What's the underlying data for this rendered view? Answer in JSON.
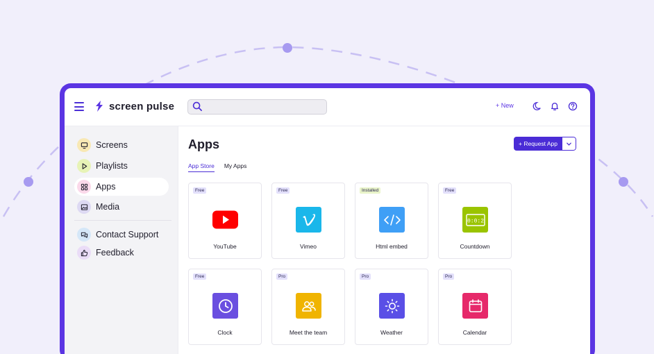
{
  "brand": {
    "name": "screen pulse"
  },
  "search": {
    "placeholder": ""
  },
  "header": {
    "new_label": "+ New"
  },
  "sidebar": {
    "items": [
      {
        "label": "Screens",
        "icon": "monitor-icon",
        "color": "#f8e8b4"
      },
      {
        "label": "Playlists",
        "icon": "play-icon",
        "color": "#e7f3b6"
      },
      {
        "label": "Apps",
        "icon": "grid-icon",
        "color": "#fbd9ea"
      },
      {
        "label": "Media",
        "icon": "image-icon",
        "color": "#ddd9f3"
      }
    ],
    "support": [
      {
        "label": "Contact Support",
        "icon": "chat-icon",
        "color": "#d5e7f8"
      },
      {
        "label": "Feedback",
        "icon": "thumbs-up-icon",
        "color": "#eadcf7"
      }
    ]
  },
  "main": {
    "title": "Apps",
    "request_label": "+ Request App",
    "tabs": [
      {
        "label": "App Store"
      },
      {
        "label": "My Apps"
      }
    ],
    "apps": [
      {
        "name": "YouTube",
        "badge": "Free",
        "color": "#f00"
      },
      {
        "name": "Vimeo",
        "badge": "Free",
        "color": "#1ab7ea"
      },
      {
        "name": "Html embed",
        "badge": "Installed",
        "color": "#3f9ff6"
      },
      {
        "name": "Countdown",
        "badge": "Free",
        "color": "#9ac400"
      },
      {
        "name": "Clock",
        "badge": "Free",
        "color": "#6a4fe0"
      },
      {
        "name": "Meet the team",
        "badge": "Pro",
        "color": "#f0b400"
      },
      {
        "name": "Weather",
        "badge": "Pro",
        "color": "#5a4fe6"
      },
      {
        "name": "Calendar",
        "badge": "Pro",
        "color": "#e6296a"
      }
    ]
  },
  "countdown_display": "0:0:2"
}
